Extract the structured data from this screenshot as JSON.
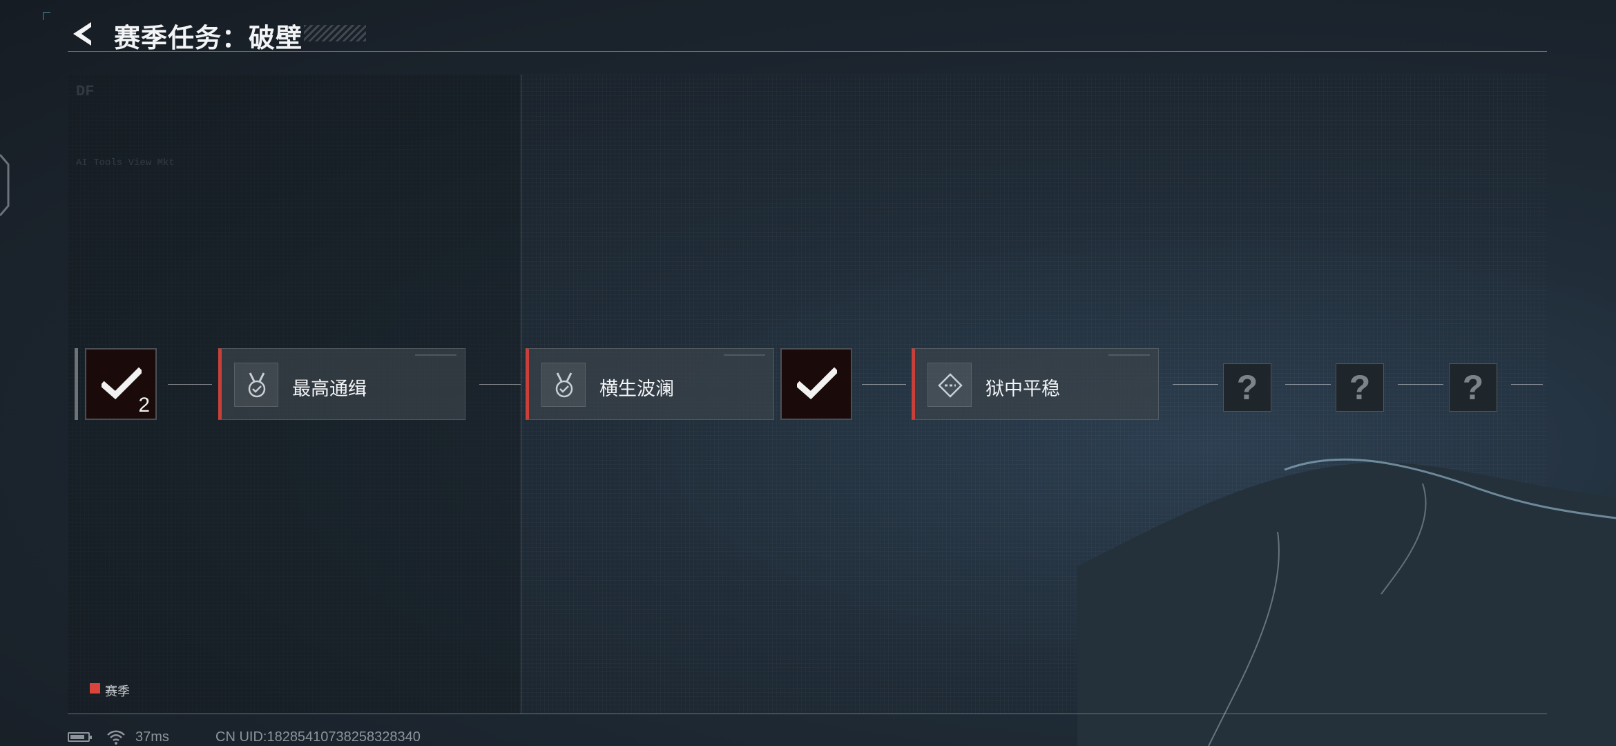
{
  "header": {
    "title": "赛季任务：破壁"
  },
  "chain": {
    "start_count": "2",
    "tasks": [
      {
        "label": "最高通缉",
        "icon": "medal-check-icon"
      },
      {
        "label": "横生波澜",
        "icon": "medal-check-icon"
      },
      {
        "label": "狱中平稳",
        "icon": "target-diamond-icon"
      }
    ],
    "locked": [
      "?",
      "?",
      "?"
    ]
  },
  "legend": {
    "label": "赛季",
    "color": "#d9443d"
  },
  "status": {
    "ping": "37ms",
    "uid": "CN UID:18285410738258328340"
  },
  "colors": {
    "accent_red": "#c9403a",
    "check_bg": "#1a0a0a"
  },
  "faint_panel": {
    "line1": "DF",
    "line2": "AI Tools View Mkt"
  }
}
